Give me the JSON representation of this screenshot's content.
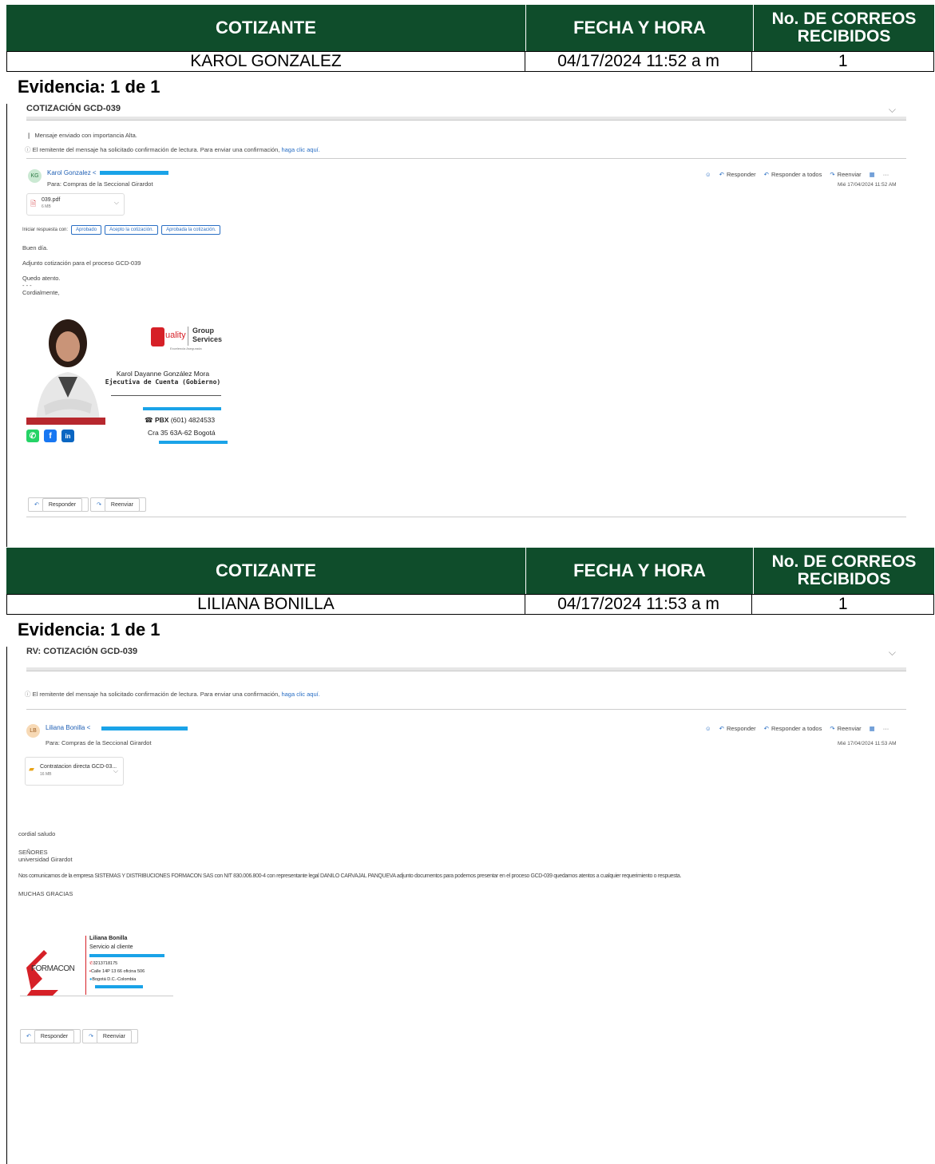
{
  "blocks": [
    {
      "header": {
        "col1": "COTIZANTE",
        "col2": "FECHA Y HORA",
        "col3": "No. DE CORREOS RECIBIDOS"
      },
      "row": {
        "cotizante": "KAROL GONZALEZ",
        "fecha": "04/17/2024  11:52 a m",
        "correos": "1"
      },
      "evidence": "Evidencia: 1 de 1",
      "email": {
        "subject": "COTIZACIÓN GCD-039",
        "importance": "Mensaje enviado con importancia Alta.",
        "receipt_text": "El remitente del mensaje ha solicitado confirmación de lectura. Para enviar una confirmación,",
        "receipt_link": "haga clic aquí.",
        "avatar": "KG",
        "sender": "Karol Gonzalez <",
        "to": "Para:  Compras de la Seccional Girardot",
        "actions": {
          "reply": "Responder",
          "reply_all": "Responder a todos",
          "forward": "Reenviar",
          "more": "···"
        },
        "date": "Mié 17/04/2024 11:52 AM",
        "attachment": {
          "name": "039.pdf",
          "size": "6 MB"
        },
        "quick_label": "Iniciar respuesta con:",
        "quick_replies": [
          "Aprobado",
          "Acepto la cotización.",
          "Aprobada la cotización."
        ],
        "body": [
          "Buen día.",
          "Adjunto cotización para el proceso GCD-039",
          "Quedo atento.",
          "- - -",
          "Cordialmente,"
        ],
        "signature": {
          "brand1": "uality",
          "brand2": "Group",
          "brand3": "Services",
          "tagline": "Excelencia Asegurada",
          "name": "Karol Dayanne González Mora",
          "title": "Ejecutiva de Cuenta (Gobierno)",
          "pbx_label": "PBX",
          "pbx": "(601) 4824533",
          "address": "Cra 35 63A-62 Bogotá"
        },
        "footer": {
          "reply": "Responder",
          "forward": "Reenviar"
        }
      }
    },
    {
      "header": {
        "col1": "COTIZANTE",
        "col2": "FECHA Y HORA",
        "col3": "No. DE CORREOS RECIBIDOS"
      },
      "row": {
        "cotizante": "LILIANA BONILLA",
        "fecha": "04/17/2024  11:53 a m",
        "correos": "1"
      },
      "evidence": "Evidencia: 1 de 1",
      "email": {
        "subject": "RV: COTIZACIÓN GCD-039",
        "receipt_text": "El remitente del mensaje ha solicitado confirmación de lectura. Para enviar una confirmación,",
        "receipt_link": "haga clic aquí.",
        "avatar": "LB",
        "sender": "Liliana Bonilla <",
        "to": "Para:  Compras de la Seccional Girardot",
        "actions": {
          "reply": "Responder",
          "reply_all": "Responder a todos",
          "forward": "Reenviar",
          "more": "···"
        },
        "date": "Mié 17/04/2024 11:53 AM",
        "attachment": {
          "name": "Contratacion directa GCD-03...",
          "size": "16 MB"
        },
        "body": [
          "cordial saludo",
          "SEÑORES",
          "universidad Girardot",
          "Nos comunicamos de la empresa SISTEMAS Y DISTRIBUCIONES FORMACON SAS con NIT 830.006.800-4 con representante legal DANILO CARVAJAL PANQUEVA adjunto documentos para podernos presentar en el proceso GCD-039 quedamos atentos a cualquier requerimiento o respuesta.",
          "MUCHAS GRACIAS"
        ],
        "signature": {
          "brand": "FORMACON",
          "name": "Liliana Bonilla",
          "title": "Servicio al cliente",
          "phone": "3213718175",
          "address": "Calle 14P 13 66 oficina 506",
          "city": "Bogotá D.C.-Colombia"
        },
        "footer": {
          "reply": "Responder",
          "forward": "Reenviar"
        }
      }
    }
  ],
  "colors": {
    "header_bg": "#0f4d2b",
    "link": "#2a6fc4",
    "redact": "#1aa3e8"
  }
}
